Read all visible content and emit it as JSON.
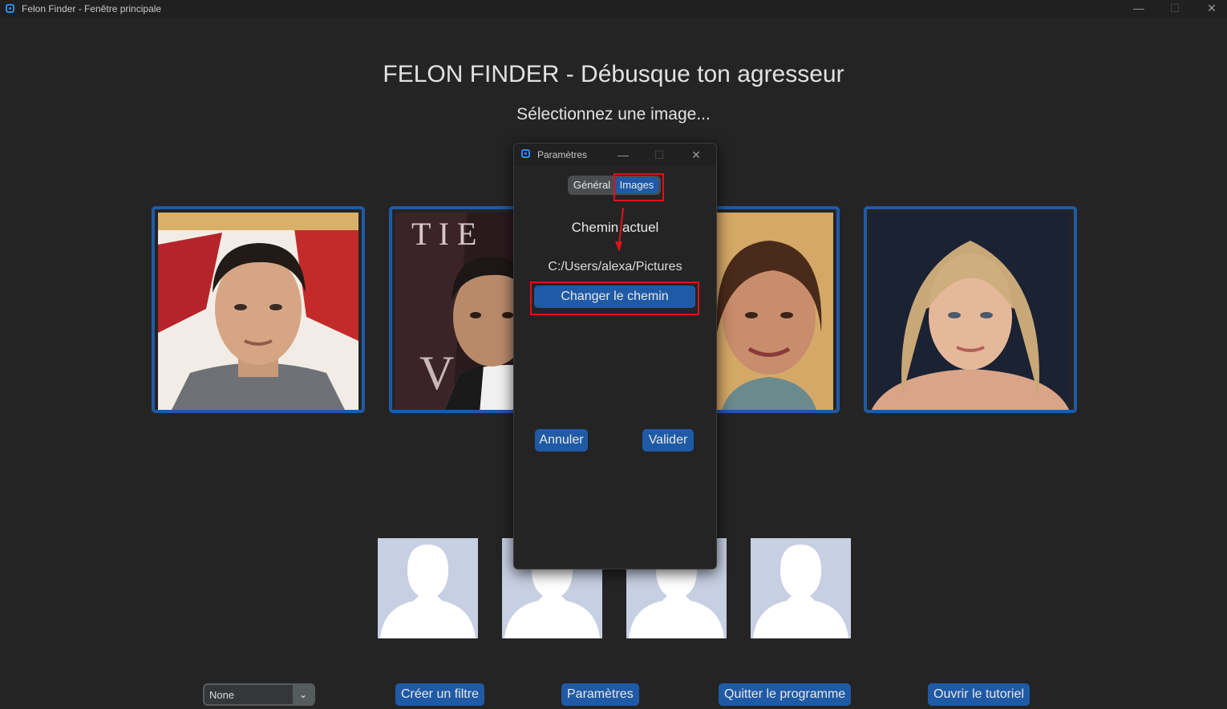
{
  "window": {
    "title": "Felon Finder - Fenêtre principale",
    "minimize": "—",
    "maximize": "☐",
    "close": "✕"
  },
  "header": {
    "title": "FELON FINDER - Débusque ton agresseur",
    "subtitle": "Sélectionnez une image..."
  },
  "gallery": {
    "photos": [
      "portrait-man-1",
      "portrait-man-2",
      "portrait-woman-1",
      "portrait-woman-2"
    ],
    "placeholders": [
      "profile-placeholder-1",
      "profile-placeholder-2",
      "profile-placeholder-3",
      "profile-placeholder-4"
    ]
  },
  "toolbar": {
    "filter_select_value": "None",
    "create_filter": "Créer un filtre",
    "settings": "Paramètres",
    "quit": "Quitter le programme",
    "tutorial": "Ouvrir le tutoriel"
  },
  "dialog": {
    "title": "Paramètres",
    "minimize": "—",
    "maximize": "☐",
    "close": "✕",
    "tabs": [
      {
        "label": "Général",
        "selected": false
      },
      {
        "label": "Images",
        "selected": true
      }
    ],
    "current_path_label": "Chemin actuel",
    "current_path_value": "C:/Users/alexa/Pictures",
    "change_path_button": "Changer le chemin",
    "cancel_button": "Annuler",
    "validate_button": "Valider"
  },
  "colors": {
    "background": "#242424",
    "accent": "#1f5aa6",
    "highlight": "#e0101a",
    "placeholder": "#c7cfe2"
  }
}
